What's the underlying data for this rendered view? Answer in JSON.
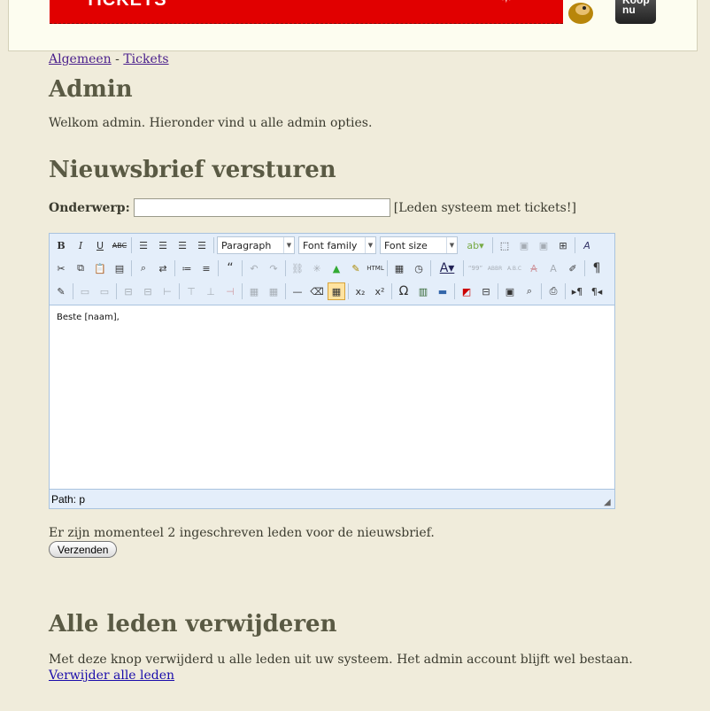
{
  "header": {
    "banner_text": "TICKETS",
    "buy_button": "Koop nu"
  },
  "breadcrumb": {
    "item1": "Algemeen",
    "separator": "-",
    "item2": "Tickets"
  },
  "admin": {
    "title": "Admin",
    "welcome": "Welkom admin. Hieronder vind u alle admin opties."
  },
  "newsletter": {
    "title": "Nieuwsbrief versturen",
    "subject_label": "Onderwerp:",
    "subject_value": "",
    "subject_hint": "[Leden systeem met tickets!]",
    "editor": {
      "format_select": "Paragraph",
      "font_family_select": "Font family",
      "font_size_select": "Font size",
      "content": "Beste [naam],",
      "path_label": "Path: p"
    },
    "members_info": "Er zijn momenteel 2 ingeschreven leden voor de nieuwsbrief.",
    "send_button": "Verzenden"
  },
  "delete_members": {
    "title": "Alle leden verwijderen",
    "description": "Met deze knop verwijderd u alle leden uit uw systeem. Het admin account blijft wel bestaan.",
    "link_text": "Verwijder alle leden"
  },
  "toolbar_icons": {
    "row1": [
      "bold-icon",
      "italic-icon",
      "underline-icon",
      "strikethrough-icon",
      "align-left-icon",
      "align-center-icon",
      "align-right-icon",
      "align-justify-icon",
      "highlight-color-icon",
      "select-area-icon",
      "layer-icon",
      "layer2-icon",
      "insert-layer-icon",
      "styles-icon"
    ],
    "row2": [
      "cut-icon",
      "copy-icon",
      "paste-icon",
      "paste-text-icon",
      "find-icon",
      "replace-icon",
      "bullet-list-icon",
      "numbered-list-icon",
      "blockquote-icon",
      "undo-icon",
      "redo-icon",
      "link-icon",
      "unlink-icon",
      "image-icon",
      "cleanup-icon",
      "html-icon",
      "insert-date-icon",
      "insert-time-icon",
      "text-color-icon",
      "cite-icon",
      "abbr-icon",
      "acronym-icon",
      "del-icon",
      "ins-icon",
      "attributes-icon",
      "show-blocks-icon"
    ],
    "row3": [
      "edit-icon",
      "table-row-icon",
      "table-props-icon",
      "merge-icon",
      "split-icon",
      "col-icon",
      "row-before-icon",
      "row-after-icon",
      "delete-row-icon",
      "insert-cell-icon",
      "delete-cell-icon",
      "horizontal-rule-icon",
      "eraser-icon",
      "visual-aid-icon",
      "subscript-icon",
      "superscript-icon",
      "omega-icon",
      "media-icon",
      "advhr-icon",
      "print-preview-icon",
      "page-break-icon",
      "fullscreen-icon",
      "preview-icon",
      "print-icon",
      "ltr-icon",
      "rtl-icon"
    ]
  }
}
